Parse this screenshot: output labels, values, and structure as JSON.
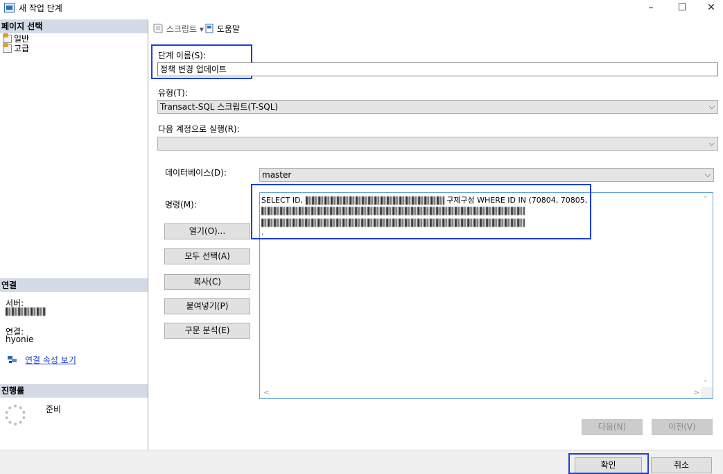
{
  "window": {
    "title": "새 작업 단계",
    "minimize": "–",
    "maximize": "☐",
    "close": "✕"
  },
  "left": {
    "select_page_header": "페이지 선택",
    "pages": [
      {
        "label": "일반"
      },
      {
        "label": "고급"
      }
    ],
    "connection_header": "연결",
    "server_label": "서버:",
    "connection_label": "연결:",
    "connection_value": "hyonie",
    "view_connection_link": "연결 속성 보기",
    "progress_header": "진행률",
    "progress_status": "준비"
  },
  "toolbar": {
    "script_label": "스크립트",
    "script_dropdown": "▾",
    "help_label": "도움말"
  },
  "form": {
    "step_name_label": "단계 이름(S):",
    "step_name_value": "정책 변경 업데이트",
    "type_label": "유형(T):",
    "type_value": "Transact-SQL 스크립트(T-SQL)",
    "run_as_label": "다음 계정으로 실행(R):",
    "run_as_value": "",
    "database_label": "데이터베이스(D):",
    "database_value": "master",
    "command_label": "명령(M):",
    "command_line1_prefix": "SELECT ID,",
    "command_line1_suffix": "구제구성 WHERE ID IN (70804, 70805,",
    "command_line4": ".",
    "chevron": "⌵"
  },
  "buttons": {
    "open": "열기(O)...",
    "select_all": "모두 선택(A)",
    "copy": "복사(C)",
    "paste": "붙여넣기(P)",
    "parse": "구문 분석(E)",
    "next": "다음(N)",
    "previous": "이전(V)",
    "ok": "확인",
    "cancel": "취소"
  },
  "scroll": {
    "up": "˄",
    "down": "˅",
    "left": "<",
    "right": ">"
  },
  "colors": {
    "highlight": "#1f3fd8",
    "section_header": "#d4dbe6",
    "link": "#1a3fc7"
  }
}
